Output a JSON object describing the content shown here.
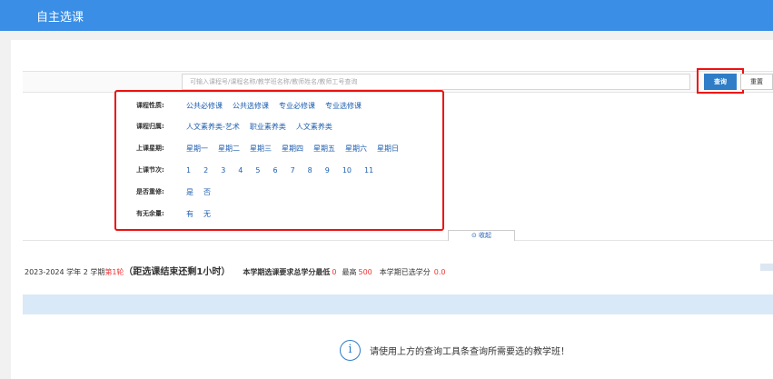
{
  "header": {
    "title": "自主选课"
  },
  "search": {
    "placeholder": "可输入课程号/课程名称/教学班名称/教师姓名/教师工号查询",
    "query_label": "查询",
    "reset_label": "重置"
  },
  "filters": [
    {
      "label": "课程性质:",
      "options": [
        "公共必修课",
        "公共选修课",
        "专业必修课",
        "专业选修课"
      ]
    },
    {
      "label": "课程归属:",
      "options": [
        "人文素养类-艺术",
        "职业素养类",
        "人文素养类"
      ]
    },
    {
      "label": "上课星期:",
      "options": [
        "星期一",
        "星期二",
        "星期三",
        "星期四",
        "星期五",
        "星期六",
        "星期日"
      ]
    },
    {
      "label": "上课节次:",
      "options": [
        "1",
        "2",
        "3",
        "4",
        "5",
        "6",
        "7",
        "8",
        "9",
        "10",
        "11"
      ]
    },
    {
      "label": "是否重修:",
      "options": [
        "是",
        "否"
      ]
    },
    {
      "label": "有无余量:",
      "options": [
        "有",
        "无"
      ]
    }
  ],
  "collapse": {
    "icon": "circle-up-icon",
    "label": "收起"
  },
  "info": {
    "term": "2023-2024 学年 2 学期",
    "round": "第1轮",
    "countdown": "（距选课结束还剩1小时）",
    "requirement_label": "本学期选课要求总学分最低",
    "min_credits": "0",
    "max_label": "最高",
    "max_credits": "500",
    "selected_label": "本学期已选学分",
    "selected_credits": "0.0"
  },
  "empty": {
    "icon": "info-icon",
    "message": "请使用上方的查询工具条查询所需要选的教学班！"
  },
  "colors": {
    "accent": "#3a8ee6",
    "link": "#1f5fb0",
    "highlight": "#e11111",
    "warning": "#e33333"
  }
}
